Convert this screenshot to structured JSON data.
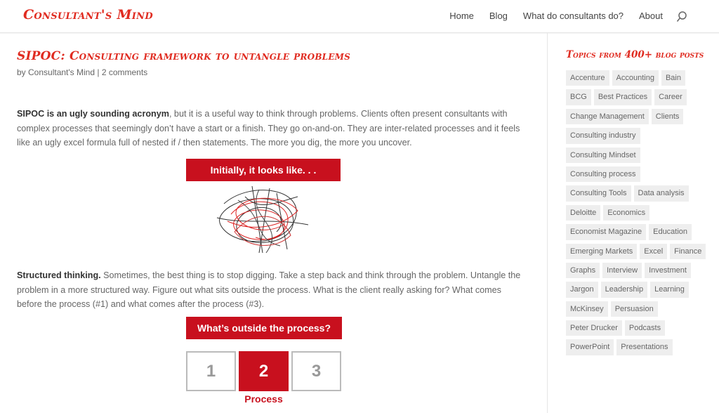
{
  "site": {
    "logo": "Consultant's Mind"
  },
  "nav": {
    "items": [
      "Home",
      "Blog",
      "What do consultants do?",
      "About"
    ],
    "search_icon": "search-icon"
  },
  "post": {
    "title": "SIPOC: Consulting framework to untangle problems",
    "meta_by": "by ",
    "author": "Consultant's Mind",
    "meta_sep": " | ",
    "comments": "2 comments",
    "p1_bold": "SIPOC is an ugly sounding acronym",
    "p1_rest": ", but it is a useful way to think through problems. Clients often present consultants with complex processes that seemingly don’t have a start or a finish. They go on-and-on. They are inter-related processes and it feels like an ugly excel formula full of nested if / then statements. The more you dig, the more you uncover.",
    "figure1_banner": "Initially, it looks like. . .",
    "p2_bold": "Structured thinking.",
    "p2_rest": " Sometimes, the best thing is to stop digging.  Take a step back and think through the problem.  Untangle the problem in a more structured way. Figure out what sits outside the process.  What is the client really asking for? What comes before the process (#1) and what comes after the process (#3).",
    "figure2_banner": "What’s outside the process?",
    "figure2_boxes": [
      "1",
      "2",
      "3"
    ],
    "figure2_label": "Process"
  },
  "sidebar": {
    "title": "Topics from 400+ blog posts",
    "tags": [
      "Accenture",
      "Accounting",
      "Bain",
      "BCG",
      "Best Practices",
      "Career",
      "Change Management",
      "Clients",
      "Consulting industry",
      "Consulting Mindset",
      "Consulting process",
      "Consulting Tools",
      "Data analysis",
      "Deloitte",
      "Economics",
      "Economist Magazine",
      "Education",
      "Emerging Markets",
      "Excel",
      "Finance",
      "Graphs",
      "Interview",
      "Investment",
      "Jargon",
      "Leadership",
      "Learning",
      "McKinsey",
      "Persuasion",
      "Peter Drucker",
      "Podcasts",
      "PowerPoint",
      "Presentations"
    ]
  },
  "colors": {
    "accent": "#e02b20",
    "figure_red": "#c8101e"
  }
}
